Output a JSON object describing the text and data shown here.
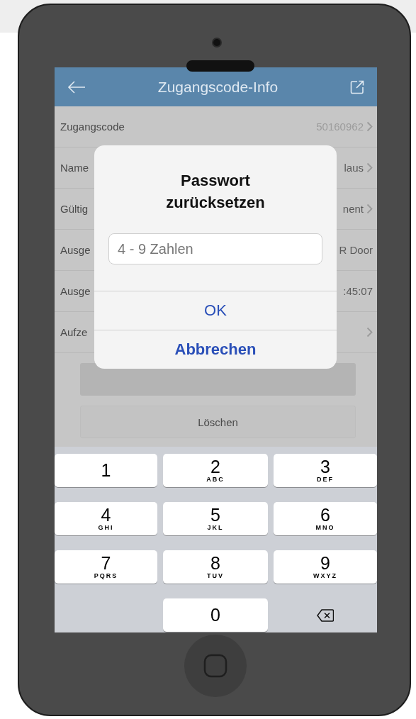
{
  "nav": {
    "title": "Zugangscode-Info"
  },
  "rows": [
    {
      "label": "Zugangscode",
      "value": "50160962",
      "chevron": true
    },
    {
      "label": "Name",
      "value": "laus",
      "chevron": true
    },
    {
      "label": "Gültig",
      "value": "nent",
      "chevron": true
    },
    {
      "label": "Ausge",
      "value": "R Door",
      "chevron": false
    },
    {
      "label": "Ausge",
      "value": ":45:07",
      "chevron": false
    },
    {
      "label": "Aufze",
      "chevron": true
    }
  ],
  "delete_button": "Löschen",
  "dialog": {
    "title": "Passwort zurücksetzen",
    "field": {
      "placeholder": "4 - 9 Zahlen"
    },
    "buttons": [
      {
        "label": "OK",
        "kind": "default"
      },
      {
        "label": "Abbrechen",
        "kind": "cancel"
      }
    ]
  },
  "keypad": [
    {
      "kind": "digit",
      "digit": "1"
    },
    {
      "kind": "digit",
      "digit": "2",
      "letters": "ABC"
    },
    {
      "kind": "digit",
      "digit": "3",
      "letters": "DEF"
    },
    {
      "kind": "digit",
      "digit": "4",
      "letters": "GHI"
    },
    {
      "kind": "digit",
      "digit": "5",
      "letters": "JKL"
    },
    {
      "kind": "digit",
      "digit": "6",
      "letters": "MNO"
    },
    {
      "kind": "digit",
      "digit": "7",
      "letters": "PQRS"
    },
    {
      "kind": "digit",
      "digit": "8",
      "letters": "TUV"
    },
    {
      "kind": "digit",
      "digit": "9",
      "letters": "WXYZ"
    },
    {
      "kind": "blank"
    },
    {
      "kind": "digit",
      "digit": "0"
    },
    {
      "kind": "delete"
    }
  ]
}
